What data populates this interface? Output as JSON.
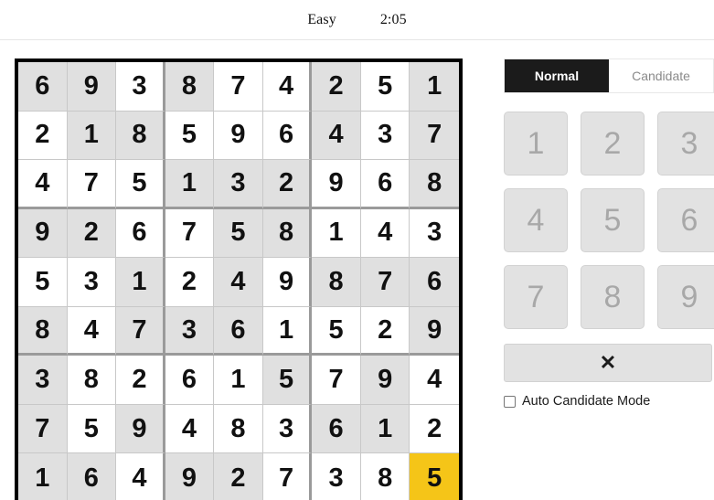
{
  "header": {
    "difficulty": "Easy",
    "timer": "2:05"
  },
  "board": {
    "rows": [
      [
        {
          "value": "6",
          "state": "given"
        },
        {
          "value": "9",
          "state": "given"
        },
        {
          "value": "3",
          "state": "user"
        },
        {
          "value": "8",
          "state": "given"
        },
        {
          "value": "7",
          "state": "user"
        },
        {
          "value": "4",
          "state": "user"
        },
        {
          "value": "2",
          "state": "given"
        },
        {
          "value": "5",
          "state": "user"
        },
        {
          "value": "1",
          "state": "given"
        }
      ],
      [
        {
          "value": "2",
          "state": "user"
        },
        {
          "value": "1",
          "state": "given"
        },
        {
          "value": "8",
          "state": "given"
        },
        {
          "value": "5",
          "state": "user"
        },
        {
          "value": "9",
          "state": "user"
        },
        {
          "value": "6",
          "state": "user"
        },
        {
          "value": "4",
          "state": "given"
        },
        {
          "value": "3",
          "state": "user"
        },
        {
          "value": "7",
          "state": "given"
        }
      ],
      [
        {
          "value": "4",
          "state": "user"
        },
        {
          "value": "7",
          "state": "user"
        },
        {
          "value": "5",
          "state": "user"
        },
        {
          "value": "1",
          "state": "given"
        },
        {
          "value": "3",
          "state": "given"
        },
        {
          "value": "2",
          "state": "given"
        },
        {
          "value": "9",
          "state": "user"
        },
        {
          "value": "6",
          "state": "user"
        },
        {
          "value": "8",
          "state": "given"
        }
      ],
      [
        {
          "value": "9",
          "state": "given"
        },
        {
          "value": "2",
          "state": "given"
        },
        {
          "value": "6",
          "state": "user"
        },
        {
          "value": "7",
          "state": "user"
        },
        {
          "value": "5",
          "state": "given"
        },
        {
          "value": "8",
          "state": "given"
        },
        {
          "value": "1",
          "state": "user"
        },
        {
          "value": "4",
          "state": "user"
        },
        {
          "value": "3",
          "state": "user"
        }
      ],
      [
        {
          "value": "5",
          "state": "user"
        },
        {
          "value": "3",
          "state": "user"
        },
        {
          "value": "1",
          "state": "given"
        },
        {
          "value": "2",
          "state": "user"
        },
        {
          "value": "4",
          "state": "given"
        },
        {
          "value": "9",
          "state": "user"
        },
        {
          "value": "8",
          "state": "given"
        },
        {
          "value": "7",
          "state": "given"
        },
        {
          "value": "6",
          "state": "given"
        }
      ],
      [
        {
          "value": "8",
          "state": "given"
        },
        {
          "value": "4",
          "state": "user"
        },
        {
          "value": "7",
          "state": "given"
        },
        {
          "value": "3",
          "state": "given"
        },
        {
          "value": "6",
          "state": "given"
        },
        {
          "value": "1",
          "state": "user"
        },
        {
          "value": "5",
          "state": "user"
        },
        {
          "value": "2",
          "state": "user"
        },
        {
          "value": "9",
          "state": "given"
        }
      ],
      [
        {
          "value": "3",
          "state": "given"
        },
        {
          "value": "8",
          "state": "user"
        },
        {
          "value": "2",
          "state": "user"
        },
        {
          "value": "6",
          "state": "user"
        },
        {
          "value": "1",
          "state": "user"
        },
        {
          "value": "5",
          "state": "given"
        },
        {
          "value": "7",
          "state": "user"
        },
        {
          "value": "9",
          "state": "given"
        },
        {
          "value": "4",
          "state": "user"
        }
      ],
      [
        {
          "value": "7",
          "state": "given"
        },
        {
          "value": "5",
          "state": "user"
        },
        {
          "value": "9",
          "state": "given"
        },
        {
          "value": "4",
          "state": "user"
        },
        {
          "value": "8",
          "state": "user"
        },
        {
          "value": "3",
          "state": "user"
        },
        {
          "value": "6",
          "state": "given"
        },
        {
          "value": "1",
          "state": "given"
        },
        {
          "value": "2",
          "state": "user"
        }
      ],
      [
        {
          "value": "1",
          "state": "given"
        },
        {
          "value": "6",
          "state": "given"
        },
        {
          "value": "4",
          "state": "user"
        },
        {
          "value": "9",
          "state": "given"
        },
        {
          "value": "2",
          "state": "given"
        },
        {
          "value": "7",
          "state": "user"
        },
        {
          "value": "3",
          "state": "user"
        },
        {
          "value": "8",
          "state": "user"
        },
        {
          "value": "5",
          "state": "selected"
        }
      ]
    ],
    "selected_cell": {
      "row": 9,
      "col": 9,
      "value": "5"
    },
    "colors": {
      "selected": "#f5c518",
      "given_cell": "#e0e0e0",
      "user_cell": "#ffffff",
      "outer_border": "#000000",
      "block_border": "#9a9a9a",
      "cell_border": "#c8c8c8"
    }
  },
  "panel": {
    "modes": [
      {
        "label": "Normal",
        "active": true
      },
      {
        "label": "Candidate",
        "active": false
      }
    ],
    "numpad": [
      "1",
      "2",
      "3",
      "4",
      "5",
      "6",
      "7",
      "8",
      "9"
    ],
    "erase": {
      "icon": "close-icon",
      "glyph": "✕"
    },
    "auto_candidate": {
      "label": "Auto Candidate Mode",
      "checked": false
    }
  }
}
